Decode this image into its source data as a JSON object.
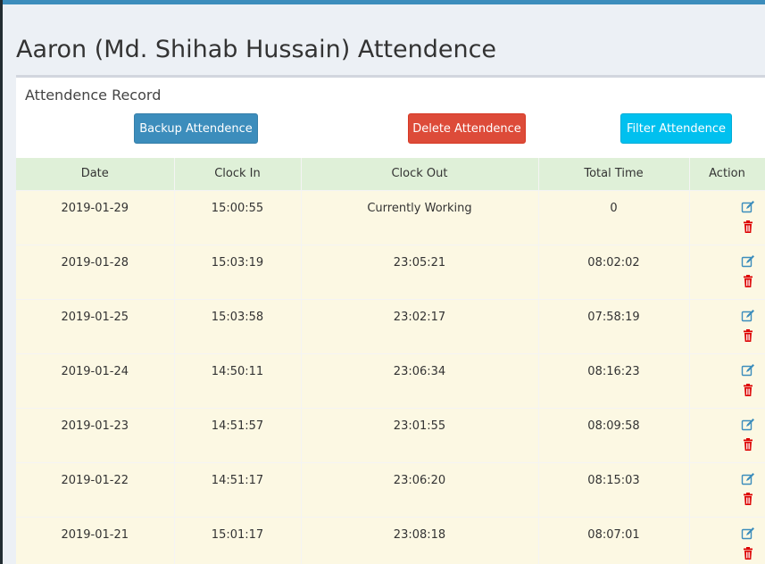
{
  "page": {
    "title": "Aaron (Md. Shihab Hussain) Attendence"
  },
  "box": {
    "title": "Attendence Record"
  },
  "buttons": {
    "backup": "Backup Attendence",
    "delete": "Delete Attendence",
    "filter": "Filter Attendence"
  },
  "table": {
    "headers": [
      "Date",
      "Clock In",
      "Clock Out",
      "Total Time",
      "Action"
    ],
    "rows": [
      {
        "date": "2019-01-29",
        "clock_in": "15:00:55",
        "clock_out": "Currently Working",
        "total": "0"
      },
      {
        "date": "2019-01-28",
        "clock_in": "15:03:19",
        "clock_out": "23:05:21",
        "total": "08:02:02"
      },
      {
        "date": "2019-01-25",
        "clock_in": "15:03:58",
        "clock_out": "23:02:17",
        "total": "07:58:19"
      },
      {
        "date": "2019-01-24",
        "clock_in": "14:50:11",
        "clock_out": "23:06:34",
        "total": "08:16:23"
      },
      {
        "date": "2019-01-23",
        "clock_in": "14:51:57",
        "clock_out": "23:01:55",
        "total": "08:09:58"
      },
      {
        "date": "2019-01-22",
        "clock_in": "14:51:17",
        "clock_out": "23:06:20",
        "total": "08:15:03"
      },
      {
        "date": "2019-01-21",
        "clock_in": "15:01:17",
        "clock_out": "23:08:18",
        "total": "08:07:01"
      }
    ]
  },
  "icons": {
    "edit": "edit-icon",
    "delete": "trash-icon"
  },
  "colors": {
    "primary": "#3c8dbc",
    "danger": "#dd4b39",
    "info": "#00c0ef",
    "header_bg": "#dff0d8",
    "row_bg": "#fcf8e3",
    "trash": "#dd0000"
  }
}
